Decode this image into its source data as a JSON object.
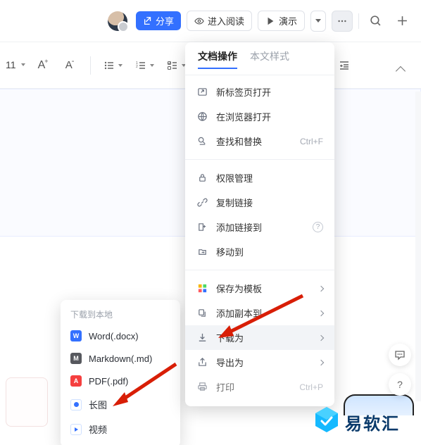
{
  "topbar": {
    "share": "分享",
    "read_mode": "进入阅读",
    "present": "演示"
  },
  "toolbar": {
    "font_size": "11"
  },
  "menu": {
    "tabs": {
      "doc_ops": "文档操作",
      "text_styles": "本文样式"
    },
    "items": {
      "open_new_tab": "新标签页打开",
      "open_in_browser": "在浏览器打开",
      "find_replace": "查找和替换",
      "find_replace_shortcut": "Ctrl+F",
      "permissions": "权限管理",
      "copy_link": "复制链接",
      "add_link_to": "添加链接到",
      "move_to": "移动到",
      "save_as_template": "保存为模板",
      "add_copy_to": "添加副本到",
      "download_as": "下载为",
      "export_as": "导出为",
      "print": "打印",
      "print_shortcut": "Ctrl+P"
    }
  },
  "submenu": {
    "title": "下载到本地",
    "word": "Word(.docx)",
    "markdown": "Markdown(.md)",
    "pdf": "PDF(.pdf)",
    "long_image": "长图",
    "video": "视频"
  },
  "watermark": {
    "text": "易软汇"
  }
}
